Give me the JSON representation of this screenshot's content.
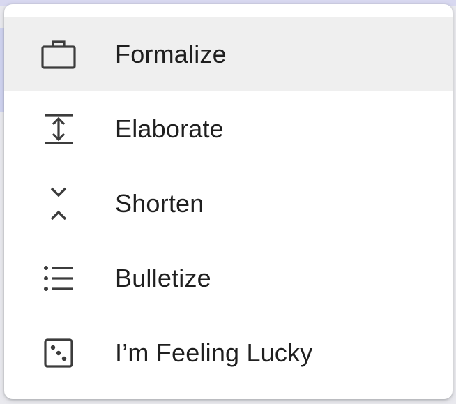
{
  "menu": {
    "items": [
      {
        "label": "Formalize",
        "icon": "briefcase-icon",
        "highlighted": true
      },
      {
        "label": "Elaborate",
        "icon": "expand-vertical-icon",
        "highlighted": false
      },
      {
        "label": "Shorten",
        "icon": "collapse-vertical-icon",
        "highlighted": false
      },
      {
        "label": "Bulletize",
        "icon": "bulleted-list-icon",
        "highlighted": false
      },
      {
        "label": "I’m Feeling Lucky",
        "icon": "dice-icon",
        "highlighted": false
      }
    ]
  },
  "colors": {
    "text": "#1f1f1f",
    "icon": "#3c3c3c",
    "highlight": "#efefef",
    "surface": "#ffffff"
  }
}
